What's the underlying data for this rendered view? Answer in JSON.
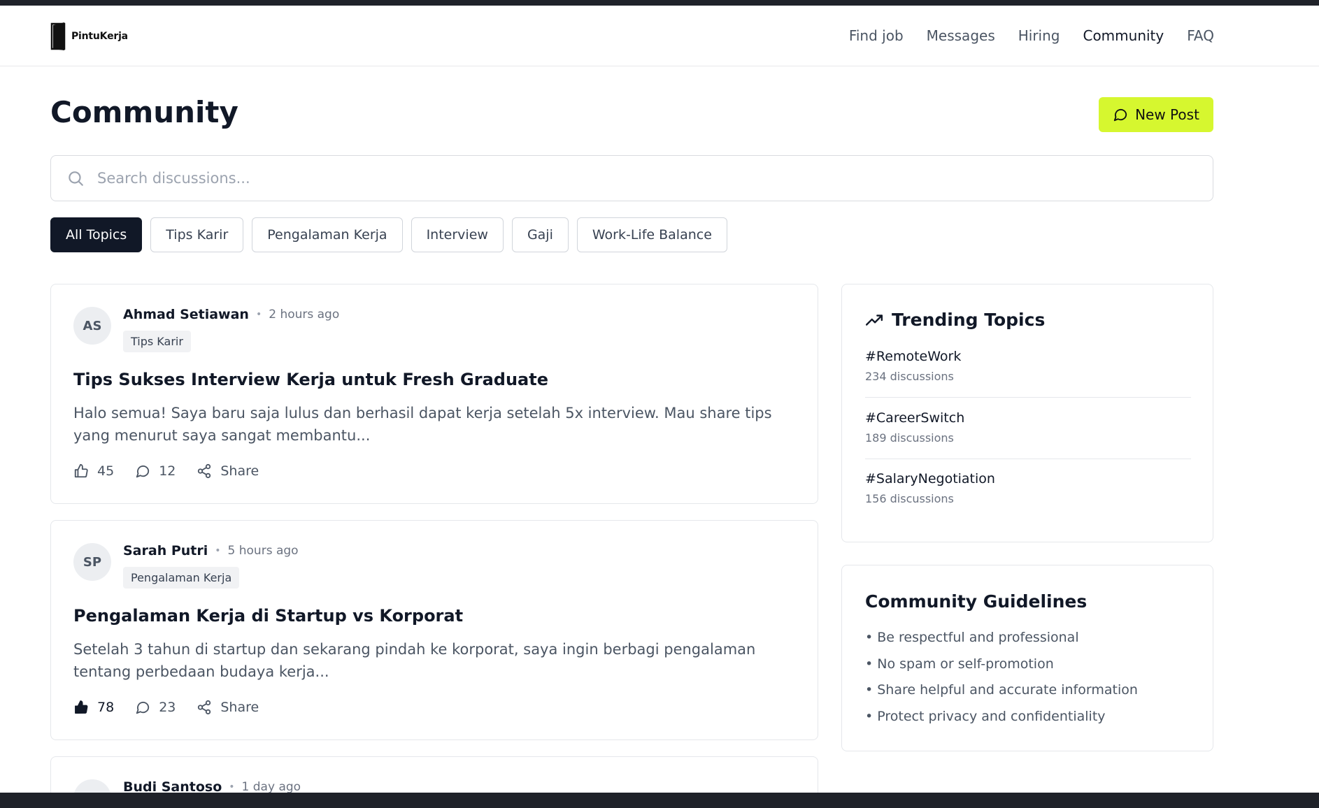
{
  "brand": {
    "name": "PintuKerja"
  },
  "nav": {
    "items": [
      {
        "label": "Find job"
      },
      {
        "label": "Messages"
      },
      {
        "label": "Hiring"
      },
      {
        "label": "Community"
      },
      {
        "label": "FAQ"
      }
    ],
    "active": "Community"
  },
  "page": {
    "title": "Community",
    "new_post_label": "New Post"
  },
  "search": {
    "placeholder": "Search discussions...",
    "value": ""
  },
  "filters": [
    {
      "label": "All Topics"
    },
    {
      "label": "Tips Karir"
    },
    {
      "label": "Pengalaman Kerja"
    },
    {
      "label": "Interview"
    },
    {
      "label": "Gaji"
    },
    {
      "label": "Work-Life Balance"
    }
  ],
  "posts": [
    {
      "initials": "AS",
      "author": "Ahmad Setiawan",
      "time": "2 hours ago",
      "tag": "Tips Karir",
      "title": "Tips Sukses Interview Kerja untuk Fresh Graduate",
      "excerpt": "Halo semua! Saya baru saja lulus dan berhasil dapat kerja setelah 5x interview. Mau share tips yang menurut saya sangat membantu...",
      "likes": "45",
      "comments": "12",
      "share_label": "Share",
      "liked": false
    },
    {
      "initials": "SP",
      "author": "Sarah Putri",
      "time": "5 hours ago",
      "tag": "Pengalaman Kerja",
      "title": "Pengalaman Kerja di Startup vs Korporat",
      "excerpt": "Setelah 3 tahun di startup dan sekarang pindah ke korporat, saya ingin berbagi pengalaman tentang perbedaan budaya kerja...",
      "likes": "78",
      "comments": "23",
      "share_label": "Share",
      "liked": true
    },
    {
      "author": "Budi Santoso",
      "time": "1 day ago"
    }
  ],
  "trending": {
    "title": "Trending Topics",
    "topics": [
      {
        "name": "#RemoteWork",
        "count": "234 discussions"
      },
      {
        "name": "#CareerSwitch",
        "count": "189 discussions"
      },
      {
        "name": "#SalaryNegotiation",
        "count": "156 discussions"
      }
    ]
  },
  "guidelines": {
    "title": "Community Guidelines",
    "rules": [
      "• Be respectful and professional",
      "• No spam or self-promotion",
      "• Share helpful and accurate information",
      "• Protect privacy and confidentiality"
    ]
  }
}
